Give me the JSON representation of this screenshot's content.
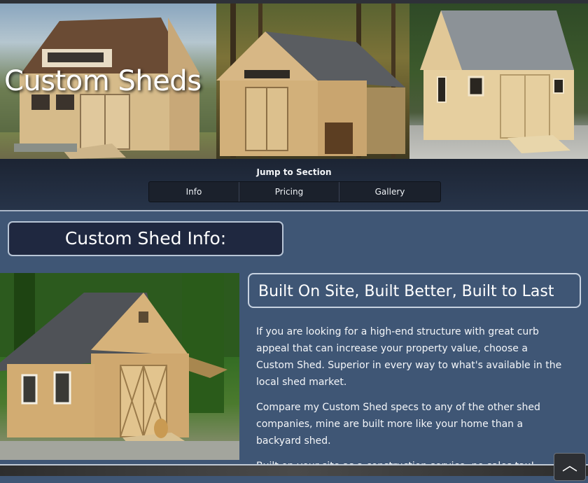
{
  "hero": {
    "title": "Custom Sheds"
  },
  "jump_nav": {
    "title": "Jump to Section",
    "items": [
      {
        "label": "Info"
      },
      {
        "label": "Pricing"
      },
      {
        "label": "Gallery"
      }
    ]
  },
  "section": {
    "heading": "Custom Shed Info:",
    "subheading": "Built On Site, Built Better, Built to Last",
    "paragraphs": [
      "If you are looking for a high-end structure with great curb appeal that can increase your property value, choose a Custom Shed. Superior in every way to what's available in the local shed market.",
      "Compare my Custom Shed specs to any of the other shed companies, mine are built more like your home than a backyard shed.",
      "Built on your site as a construction service, no sales tax!"
    ]
  },
  "back_to_top": {
    "icon": "chevron-up-icon",
    "glyph": "︿"
  }
}
